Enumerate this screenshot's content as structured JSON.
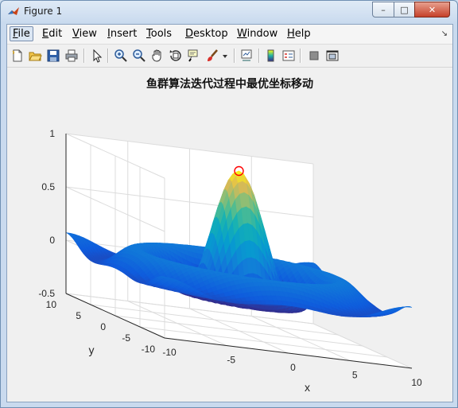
{
  "window": {
    "title": "Figure 1"
  },
  "title_buttons": {
    "minimize": "–",
    "maximize": "□",
    "close": "✕"
  },
  "menubar": {
    "items": [
      {
        "label": "File",
        "u": "F",
        "rest": "ile"
      },
      {
        "label": "Edit",
        "u": "E",
        "rest": "dit"
      },
      {
        "label": "View",
        "u": "V",
        "rest": "iew"
      },
      {
        "label": "Insert",
        "u": "I",
        "rest": "nsert"
      },
      {
        "label": "Tools",
        "u": "T",
        "rest": "ools"
      },
      {
        "label": "Desktop",
        "u": "D",
        "rest": "esktop"
      },
      {
        "label": "Window",
        "u": "W",
        "rest": "indow"
      },
      {
        "label": "Help",
        "u": "H",
        "rest": "elp"
      }
    ],
    "dock_symbol": "↘"
  },
  "toolbar": {
    "icons": [
      "new-figure-icon",
      "open-file-icon",
      "save-icon",
      "print-icon",
      "edit-plot-arrow-icon",
      "zoom-in-icon",
      "zoom-out-icon",
      "pan-hand-icon",
      "rotate-3d-icon",
      "data-cursor-icon",
      "brush-icon",
      "brush-dropdown-icon",
      "link-plot-icon",
      "colorbar-icon",
      "legend-icon",
      "hide-plot-tools-icon",
      "show-plot-tools-icon"
    ]
  },
  "chart_data": {
    "type": "surface",
    "title": "鱼群算法迭代过程中最优坐标移动",
    "function": "sin(r)/r, r = sqrt(x^2 + y^2)",
    "xlabel": "x",
    "ylabel": "y",
    "zlabel": "",
    "xlim": [
      -10,
      10
    ],
    "ylim": [
      -10,
      10
    ],
    "zlim": [
      -0.5,
      1
    ],
    "x_ticks": [
      -10,
      -5,
      0,
      5,
      10
    ],
    "y_ticks": [
      -10,
      -5,
      0,
      5,
      10
    ],
    "z_ticks": [
      -0.5,
      0,
      0.5,
      1
    ],
    "z_tick_labels": [
      "-0.5",
      "0",
      "0.5",
      "1"
    ],
    "colormap": "parula",
    "grid": true,
    "marker": {
      "shape": "circle",
      "color": "#ff0000",
      "x": 0,
      "y": 0,
      "z": 1
    }
  }
}
